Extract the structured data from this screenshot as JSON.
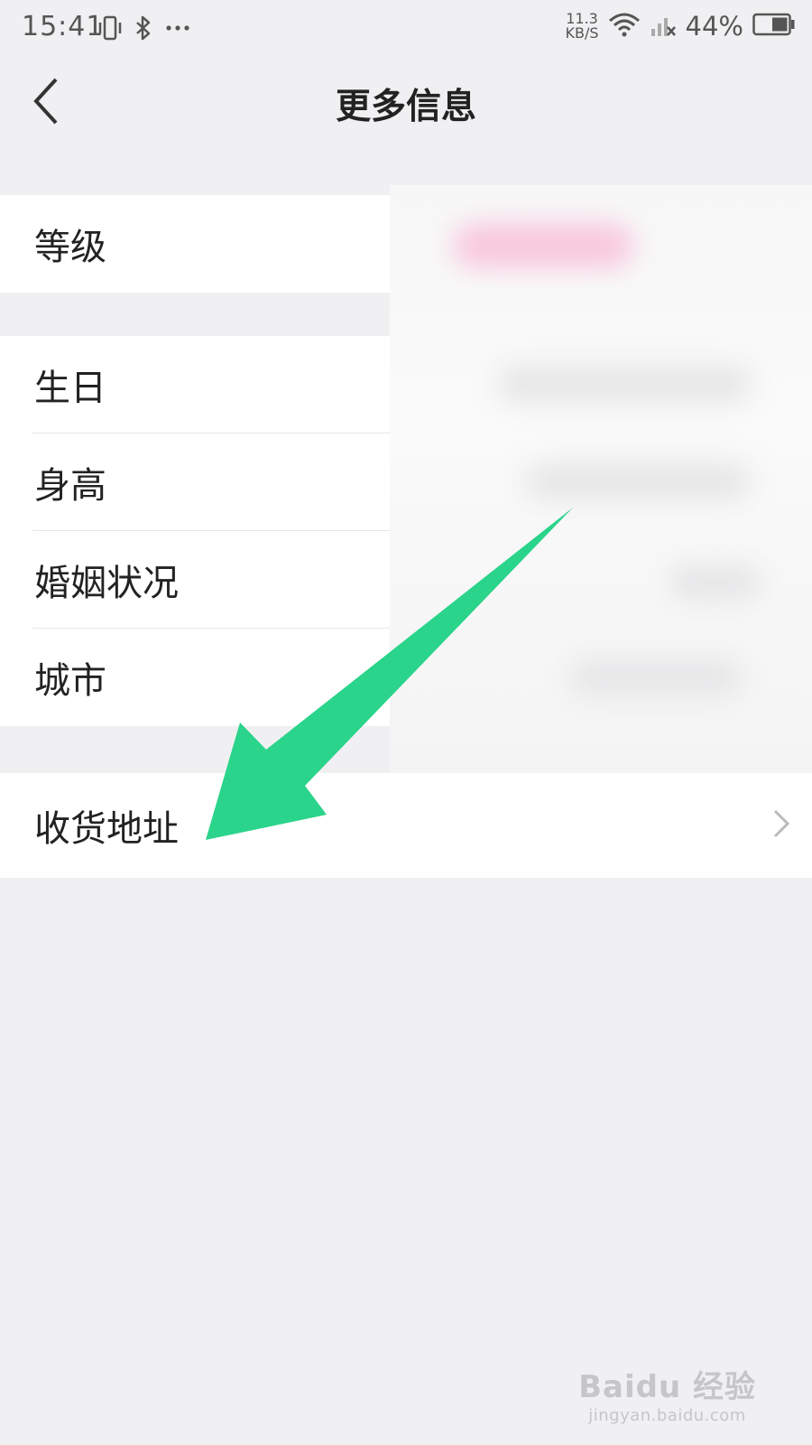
{
  "status_bar": {
    "time": "15:41",
    "net_speed_value": "11.3",
    "net_speed_unit": "KB/S",
    "battery": "44%",
    "icons": [
      "vibrate-icon",
      "bluetooth-icon",
      "more-dots-icon",
      "wifi-icon",
      "signal-icon",
      "battery-icon"
    ]
  },
  "header": {
    "title": "更多信息",
    "back_icon": "chevron-left-icon"
  },
  "sections": {
    "level": {
      "label": "等级"
    },
    "profile": {
      "birthday": "生日",
      "height": "身高",
      "marital_status": "婚姻状况",
      "city": "城市"
    },
    "address": {
      "label": "收货地址",
      "chevron_icon": "chevron-right-icon"
    }
  },
  "annotation": {
    "arrow_color": "#2ad48a"
  },
  "watermark": {
    "brand": "Baidu 经验",
    "url": "jingyan.baidu.com"
  },
  "colors": {
    "background": "#f0f0f2",
    "row_background": "#ffffff",
    "text": "#222222",
    "accent_arrow": "#2ad48a"
  }
}
